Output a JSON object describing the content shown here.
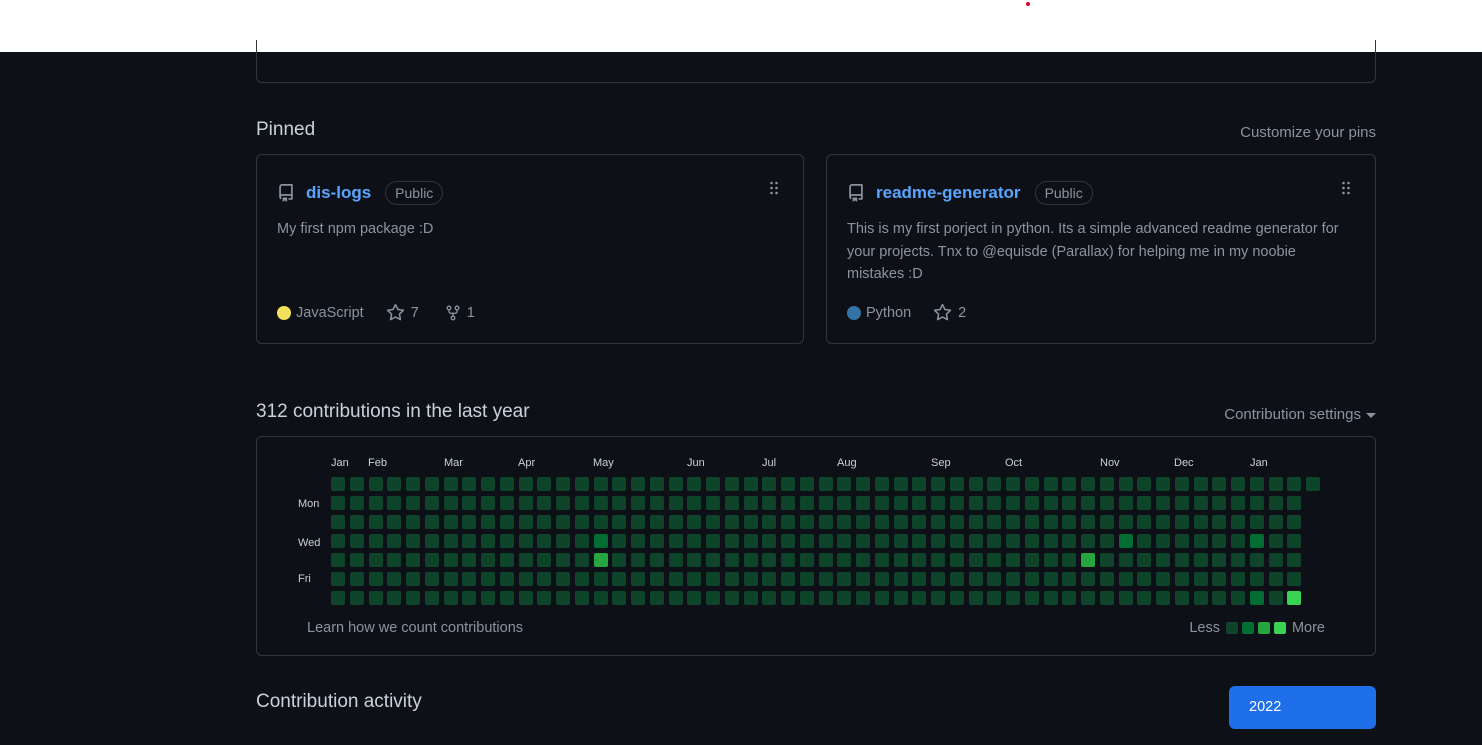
{
  "pinned": {
    "title": "Pinned",
    "customize_link": "Customize your pins",
    "repos": [
      {
        "name": "dis-logs",
        "visibility": "Public",
        "description": "My first npm package :D",
        "language": "JavaScript",
        "language_color": "#f1e05a",
        "stars": "7",
        "forks": "1"
      },
      {
        "name": "readme-generator",
        "visibility": "Public",
        "description": "This is my first porject in python. Its a simple advanced readme generator for your projects. Tnx to @equisde (Parallax) for helping me in my noobie mistakes :D",
        "language": "Python",
        "language_color": "#3572a5",
        "stars": "2"
      }
    ]
  },
  "contributions": {
    "title": "312 contributions in the last year",
    "settings_label": "Contribution settings",
    "months": [
      "Jan",
      "Feb",
      "Mar",
      "Apr",
      "May",
      "Jun",
      "Jul",
      "Aug",
      "Sep",
      "Oct",
      "Nov",
      "Dec",
      "Jan"
    ],
    "days": [
      "Mon",
      "Wed",
      "Fri"
    ],
    "learn_link": "Learn how we count contributions",
    "legend_less": "Less",
    "legend_more": "More",
    "level_colors": [
      "#0e4429",
      "#006d32",
      "#26a641",
      "#39d353"
    ],
    "weeks": 53,
    "last_week_days": 1,
    "highlights": [
      {
        "week": 14,
        "day": 3,
        "level": 1
      },
      {
        "week": 14,
        "day": 4,
        "level": 2
      },
      {
        "week": 40,
        "day": 4,
        "level": 2
      },
      {
        "week": 42,
        "day": 3,
        "level": 1
      },
      {
        "week": 49,
        "day": 3,
        "level": 1
      },
      {
        "week": 49,
        "day": 6,
        "level": 1
      },
      {
        "week": 51,
        "day": 6,
        "level": 3
      }
    ]
  },
  "activity": {
    "title": "Contribution activity",
    "year_button": "2022"
  }
}
